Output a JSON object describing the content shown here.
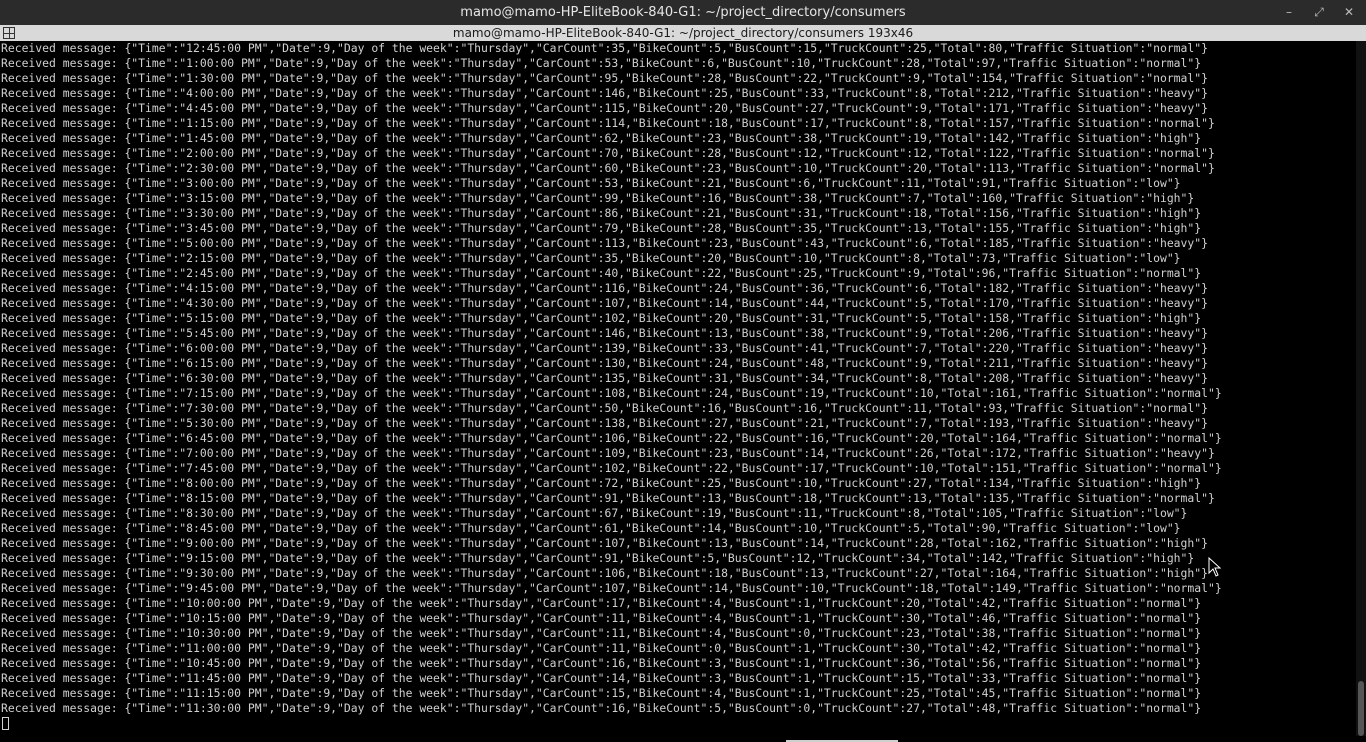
{
  "window": {
    "title": "mamo@mamo-HP-EliteBook-840-G1: ~/project_directory/consumers",
    "tab_title": "mamo@mamo-HP-EliteBook-840-G1: ~/project_directory/consumers 193x46",
    "controls": {
      "minimize": "–",
      "restore": "⤢",
      "close": "✕"
    }
  },
  "terminal": {
    "lines": [
      "Received message: {\"Time\":\"12:45:00 PM\",\"Date\":9,\"Day of the week\":\"Thursday\",\"CarCount\":35,\"BikeCount\":5,\"BusCount\":15,\"TruckCount\":25,\"Total\":80,\"Traffic Situation\":\"normal\"}",
      "Received message: {\"Time\":\"1:00:00 PM\",\"Date\":9,\"Day of the week\":\"Thursday\",\"CarCount\":53,\"BikeCount\":6,\"BusCount\":10,\"TruckCount\":28,\"Total\":97,\"Traffic Situation\":\"normal\"}",
      "Received message: {\"Time\":\"1:30:00 PM\",\"Date\":9,\"Day of the week\":\"Thursday\",\"CarCount\":95,\"BikeCount\":28,\"BusCount\":22,\"TruckCount\":9,\"Total\":154,\"Traffic Situation\":\"normal\"}",
      "Received message: {\"Time\":\"4:00:00 PM\",\"Date\":9,\"Day of the week\":\"Thursday\",\"CarCount\":146,\"BikeCount\":25,\"BusCount\":33,\"TruckCount\":8,\"Total\":212,\"Traffic Situation\":\"heavy\"}",
      "Received message: {\"Time\":\"4:45:00 PM\",\"Date\":9,\"Day of the week\":\"Thursday\",\"CarCount\":115,\"BikeCount\":20,\"BusCount\":27,\"TruckCount\":9,\"Total\":171,\"Traffic Situation\":\"heavy\"}",
      "Received message: {\"Time\":\"1:15:00 PM\",\"Date\":9,\"Day of the week\":\"Thursday\",\"CarCount\":114,\"BikeCount\":18,\"BusCount\":17,\"TruckCount\":8,\"Total\":157,\"Traffic Situation\":\"normal\"}",
      "Received message: {\"Time\":\"1:45:00 PM\",\"Date\":9,\"Day of the week\":\"Thursday\",\"CarCount\":62,\"BikeCount\":23,\"BusCount\":38,\"TruckCount\":19,\"Total\":142,\"Traffic Situation\":\"high\"}",
      "Received message: {\"Time\":\"2:00:00 PM\",\"Date\":9,\"Day of the week\":\"Thursday\",\"CarCount\":70,\"BikeCount\":28,\"BusCount\":12,\"TruckCount\":12,\"Total\":122,\"Traffic Situation\":\"normal\"}",
      "Received message: {\"Time\":\"2:30:00 PM\",\"Date\":9,\"Day of the week\":\"Thursday\",\"CarCount\":60,\"BikeCount\":23,\"BusCount\":10,\"TruckCount\":20,\"Total\":113,\"Traffic Situation\":\"normal\"}",
      "Received message: {\"Time\":\"3:00:00 PM\",\"Date\":9,\"Day of the week\":\"Thursday\",\"CarCount\":53,\"BikeCount\":21,\"BusCount\":6,\"TruckCount\":11,\"Total\":91,\"Traffic Situation\":\"low\"}",
      "Received message: {\"Time\":\"3:15:00 PM\",\"Date\":9,\"Day of the week\":\"Thursday\",\"CarCount\":99,\"BikeCount\":16,\"BusCount\":38,\"TruckCount\":7,\"Total\":160,\"Traffic Situation\":\"high\"}",
      "Received message: {\"Time\":\"3:30:00 PM\",\"Date\":9,\"Day of the week\":\"Thursday\",\"CarCount\":86,\"BikeCount\":21,\"BusCount\":31,\"TruckCount\":18,\"Total\":156,\"Traffic Situation\":\"high\"}",
      "Received message: {\"Time\":\"3:45:00 PM\",\"Date\":9,\"Day of the week\":\"Thursday\",\"CarCount\":79,\"BikeCount\":28,\"BusCount\":35,\"TruckCount\":13,\"Total\":155,\"Traffic Situation\":\"high\"}",
      "Received message: {\"Time\":\"5:00:00 PM\",\"Date\":9,\"Day of the week\":\"Thursday\",\"CarCount\":113,\"BikeCount\":23,\"BusCount\":43,\"TruckCount\":6,\"Total\":185,\"Traffic Situation\":\"heavy\"}",
      "Received message: {\"Time\":\"2:15:00 PM\",\"Date\":9,\"Day of the week\":\"Thursday\",\"CarCount\":35,\"BikeCount\":20,\"BusCount\":10,\"TruckCount\":8,\"Total\":73,\"Traffic Situation\":\"low\"}",
      "Received message: {\"Time\":\"2:45:00 PM\",\"Date\":9,\"Day of the week\":\"Thursday\",\"CarCount\":40,\"BikeCount\":22,\"BusCount\":25,\"TruckCount\":9,\"Total\":96,\"Traffic Situation\":\"normal\"}",
      "Received message: {\"Time\":\"4:15:00 PM\",\"Date\":9,\"Day of the week\":\"Thursday\",\"CarCount\":116,\"BikeCount\":24,\"BusCount\":36,\"TruckCount\":6,\"Total\":182,\"Traffic Situation\":\"heavy\"}",
      "Received message: {\"Time\":\"4:30:00 PM\",\"Date\":9,\"Day of the week\":\"Thursday\",\"CarCount\":107,\"BikeCount\":14,\"BusCount\":44,\"TruckCount\":5,\"Total\":170,\"Traffic Situation\":\"heavy\"}",
      "Received message: {\"Time\":\"5:15:00 PM\",\"Date\":9,\"Day of the week\":\"Thursday\",\"CarCount\":102,\"BikeCount\":20,\"BusCount\":31,\"TruckCount\":5,\"Total\":158,\"Traffic Situation\":\"high\"}",
      "Received message: {\"Time\":\"5:45:00 PM\",\"Date\":9,\"Day of the week\":\"Thursday\",\"CarCount\":146,\"BikeCount\":13,\"BusCount\":38,\"TruckCount\":9,\"Total\":206,\"Traffic Situation\":\"heavy\"}",
      "Received message: {\"Time\":\"6:00:00 PM\",\"Date\":9,\"Day of the week\":\"Thursday\",\"CarCount\":139,\"BikeCount\":33,\"BusCount\":41,\"TruckCount\":7,\"Total\":220,\"Traffic Situation\":\"heavy\"}",
      "Received message: {\"Time\":\"6:15:00 PM\",\"Date\":9,\"Day of the week\":\"Thursday\",\"CarCount\":130,\"BikeCount\":24,\"BusCount\":48,\"TruckCount\":9,\"Total\":211,\"Traffic Situation\":\"heavy\"}",
      "Received message: {\"Time\":\"6:30:00 PM\",\"Date\":9,\"Day of the week\":\"Thursday\",\"CarCount\":135,\"BikeCount\":31,\"BusCount\":34,\"TruckCount\":8,\"Total\":208,\"Traffic Situation\":\"heavy\"}",
      "Received message: {\"Time\":\"7:15:00 PM\",\"Date\":9,\"Day of the week\":\"Thursday\",\"CarCount\":108,\"BikeCount\":24,\"BusCount\":19,\"TruckCount\":10,\"Total\":161,\"Traffic Situation\":\"normal\"}",
      "Received message: {\"Time\":\"7:30:00 PM\",\"Date\":9,\"Day of the week\":\"Thursday\",\"CarCount\":50,\"BikeCount\":16,\"BusCount\":16,\"TruckCount\":11,\"Total\":93,\"Traffic Situation\":\"normal\"}",
      "Received message: {\"Time\":\"5:30:00 PM\",\"Date\":9,\"Day of the week\":\"Thursday\",\"CarCount\":138,\"BikeCount\":27,\"BusCount\":21,\"TruckCount\":7,\"Total\":193,\"Traffic Situation\":\"heavy\"}",
      "Received message: {\"Time\":\"6:45:00 PM\",\"Date\":9,\"Day of the week\":\"Thursday\",\"CarCount\":106,\"BikeCount\":22,\"BusCount\":16,\"TruckCount\":20,\"Total\":164,\"Traffic Situation\":\"normal\"}",
      "Received message: {\"Time\":\"7:00:00 PM\",\"Date\":9,\"Day of the week\":\"Thursday\",\"CarCount\":109,\"BikeCount\":23,\"BusCount\":14,\"TruckCount\":26,\"Total\":172,\"Traffic Situation\":\"heavy\"}",
      "Received message: {\"Time\":\"7:45:00 PM\",\"Date\":9,\"Day of the week\":\"Thursday\",\"CarCount\":102,\"BikeCount\":22,\"BusCount\":17,\"TruckCount\":10,\"Total\":151,\"Traffic Situation\":\"normal\"}",
      "Received message: {\"Time\":\"8:00:00 PM\",\"Date\":9,\"Day of the week\":\"Thursday\",\"CarCount\":72,\"BikeCount\":25,\"BusCount\":10,\"TruckCount\":27,\"Total\":134,\"Traffic Situation\":\"high\"}",
      "Received message: {\"Time\":\"8:15:00 PM\",\"Date\":9,\"Day of the week\":\"Thursday\",\"CarCount\":91,\"BikeCount\":13,\"BusCount\":18,\"TruckCount\":13,\"Total\":135,\"Traffic Situation\":\"normal\"}",
      "Received message: {\"Time\":\"8:30:00 PM\",\"Date\":9,\"Day of the week\":\"Thursday\",\"CarCount\":67,\"BikeCount\":19,\"BusCount\":11,\"TruckCount\":8,\"Total\":105,\"Traffic Situation\":\"low\"}",
      "Received message: {\"Time\":\"8:45:00 PM\",\"Date\":9,\"Day of the week\":\"Thursday\",\"CarCount\":61,\"BikeCount\":14,\"BusCount\":10,\"TruckCount\":5,\"Total\":90,\"Traffic Situation\":\"low\"}",
      "Received message: {\"Time\":\"9:00:00 PM\",\"Date\":9,\"Day of the week\":\"Thursday\",\"CarCount\":107,\"BikeCount\":13,\"BusCount\":14,\"TruckCount\":28,\"Total\":162,\"Traffic Situation\":\"high\"}",
      "Received message: {\"Time\":\"9:15:00 PM\",\"Date\":9,\"Day of the week\":\"Thursday\",\"CarCount\":91,\"BikeCount\":5,\"BusCount\":12,\"TruckCount\":34,\"Total\":142,\"Traffic Situation\":\"high\"}",
      "Received message: {\"Time\":\"9:30:00 PM\",\"Date\":9,\"Day of the week\":\"Thursday\",\"CarCount\":106,\"BikeCount\":18,\"BusCount\":13,\"TruckCount\":27,\"Total\":164,\"Traffic Situation\":\"high\"}",
      "Received message: {\"Time\":\"9:45:00 PM\",\"Date\":9,\"Day of the week\":\"Thursday\",\"CarCount\":107,\"BikeCount\":14,\"BusCount\":10,\"TruckCount\":18,\"Total\":149,\"Traffic Situation\":\"normal\"}",
      "Received message: {\"Time\":\"10:00:00 PM\",\"Date\":9,\"Day of the week\":\"Thursday\",\"CarCount\":17,\"BikeCount\":4,\"BusCount\":1,\"TruckCount\":20,\"Total\":42,\"Traffic Situation\":\"normal\"}",
      "Received message: {\"Time\":\"10:15:00 PM\",\"Date\":9,\"Day of the week\":\"Thursday\",\"CarCount\":11,\"BikeCount\":4,\"BusCount\":1,\"TruckCount\":30,\"Total\":46,\"Traffic Situation\":\"normal\"}",
      "Received message: {\"Time\":\"10:30:00 PM\",\"Date\":9,\"Day of the week\":\"Thursday\",\"CarCount\":11,\"BikeCount\":4,\"BusCount\":0,\"TruckCount\":23,\"Total\":38,\"Traffic Situation\":\"normal\"}",
      "Received message: {\"Time\":\"11:00:00 PM\",\"Date\":9,\"Day of the week\":\"Thursday\",\"CarCount\":11,\"BikeCount\":0,\"BusCount\":1,\"TruckCount\":30,\"Total\":42,\"Traffic Situation\":\"normal\"}",
      "Received message: {\"Time\":\"10:45:00 PM\",\"Date\":9,\"Day of the week\":\"Thursday\",\"CarCount\":16,\"BikeCount\":3,\"BusCount\":1,\"TruckCount\":36,\"Total\":56,\"Traffic Situation\":\"normal\"}",
      "Received message: {\"Time\":\"11:45:00 PM\",\"Date\":9,\"Day of the week\":\"Thursday\",\"CarCount\":14,\"BikeCount\":3,\"BusCount\":1,\"TruckCount\":15,\"Total\":33,\"Traffic Situation\":\"normal\"}",
      "Received message: {\"Time\":\"11:15:00 PM\",\"Date\":9,\"Day of the week\":\"Thursday\",\"CarCount\":15,\"BikeCount\":4,\"BusCount\":1,\"TruckCount\":25,\"Total\":45,\"Traffic Situation\":\"normal\"}",
      "Received message: {\"Time\":\"11:30:00 PM\",\"Date\":9,\"Day of the week\":\"Thursday\",\"CarCount\":16,\"BikeCount\":5,\"BusCount\":0,\"TruckCount\":27,\"Total\":48,\"Traffic Situation\":\"normal\"}"
    ]
  }
}
